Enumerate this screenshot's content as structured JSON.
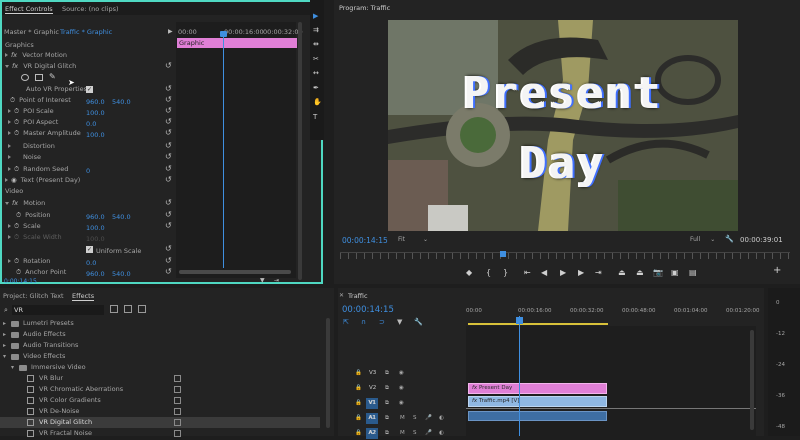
{
  "effect_controls": {
    "tab_effect_controls": "Effect Controls",
    "tab_source": "Source: (no clips)",
    "master_label": "Master * Graphic",
    "clip_label": "Traffic * Graphic",
    "times": [
      "00:00",
      "00:00:16:00",
      "00:00:32:00"
    ],
    "graphic_bar": "Graphic",
    "section_graphics": "Graphics",
    "vector_motion": "Vector Motion",
    "vr_digital_glitch": "VR Digital Glitch",
    "auto_vr": "Auto VR Properties",
    "poi_label": "Point of Interest",
    "poi_x": "960.0",
    "poi_y": "540.0",
    "poi_scale_label": "POI Scale",
    "poi_scale": "100.0",
    "poi_aspect_label": "POI Aspect",
    "poi_aspect": "0.0",
    "master_amp_label": "Master Amplitude",
    "master_amp": "100.0",
    "distortion": "Distortion",
    "noise": "Noise",
    "random_seed_label": "Random Seed",
    "random_seed": "0",
    "text_layer": "Text (Present Day)",
    "section_video": "Video",
    "motion": "Motion",
    "position_label": "Position",
    "position_x": "960.0",
    "position_y": "540.0",
    "scale_label": "Scale",
    "scale": "100.0",
    "scale_width_label": "Scale Width",
    "scale_width": "100.0",
    "uniform_scale": "Uniform Scale",
    "rotation_label": "Rotation",
    "rotation": "0.0",
    "anchor_label": "Anchor Point",
    "anchor_x": "960.0",
    "anchor_y": "540.0",
    "bottom_time": "0:00:14:15"
  },
  "program": {
    "title": "Program: Traffic",
    "overlay_line1": "Present",
    "overlay_line2": "Day",
    "timecode": "00:00:14:15",
    "fit": "Fit",
    "quality": "Full",
    "duration": "00:00:39:01"
  },
  "project": {
    "tab_project": "Project: Glitch Text",
    "tab_effects": "Effects",
    "search_value": "VR",
    "items": [
      {
        "label": "Lumetri Presets",
        "type": "folder",
        "indent": 1
      },
      {
        "label": "Audio Effects",
        "type": "folder",
        "indent": 1
      },
      {
        "label": "Audio Transitions",
        "type": "folder",
        "indent": 1
      },
      {
        "label": "Video Effects",
        "type": "folder",
        "indent": 1,
        "open": true
      },
      {
        "label": "Immersive Video",
        "type": "folder",
        "indent": 2,
        "open": true
      },
      {
        "label": "VR Blur",
        "type": "effect",
        "indent": 3
      },
      {
        "label": "VR Chromatic Aberrations",
        "type": "effect",
        "indent": 3
      },
      {
        "label": "VR Color Gradients",
        "type": "effect",
        "indent": 3
      },
      {
        "label": "VR De-Noise",
        "type": "effect",
        "indent": 3
      },
      {
        "label": "VR Digital Glitch",
        "type": "effect",
        "indent": 3,
        "selected": true
      },
      {
        "label": "VR Fractal Noise",
        "type": "effect",
        "indent": 3
      }
    ]
  },
  "timeline": {
    "title": "Traffic",
    "timecode": "00:00:14:15",
    "ruler": [
      "00:00",
      "00:00:16:00",
      "00:00:32:00",
      "00:00:48:00",
      "00:01:04:00",
      "00:01:20:00"
    ],
    "tracks": [
      {
        "id": "V3",
        "src": ""
      },
      {
        "id": "V2",
        "src": ""
      },
      {
        "id": "V1",
        "src": "V1"
      },
      {
        "id": "A1",
        "src": "A1"
      },
      {
        "id": "A2",
        "src": "A2"
      }
    ],
    "clip_v2": "Present Day",
    "clip_v1": "Traffic.mp4 [V]",
    "meter_labels": [
      "0",
      "-12",
      "-24",
      "-36",
      "-48"
    ],
    "colors": {
      "graphic_clip": "#e07fd6",
      "video_clip": "#8fb7e2",
      "audio_clip": "#3e6ea3",
      "accent": "#3f8fe0"
    }
  }
}
